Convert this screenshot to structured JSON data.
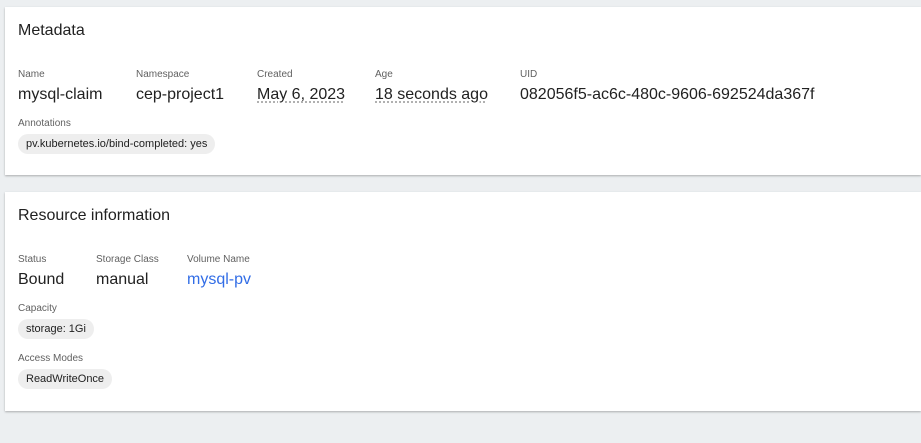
{
  "metadata": {
    "title": "Metadata",
    "name": {
      "label": "Name",
      "value": "mysql-claim"
    },
    "namespace": {
      "label": "Namespace",
      "value": "cep-project1"
    },
    "created": {
      "label": "Created",
      "value": "May 6, 2023"
    },
    "age": {
      "label": "Age",
      "value": "18 seconds ago"
    },
    "uid": {
      "label": "UID",
      "value": "082056f5-ac6c-480c-9606-692524da367f"
    },
    "annotations": {
      "label": "Annotations",
      "chips": [
        "pv.kubernetes.io/bind-completed: yes"
      ]
    }
  },
  "resource": {
    "title": "Resource information",
    "status": {
      "label": "Status",
      "value": "Bound"
    },
    "storage_class": {
      "label": "Storage Class",
      "value": "manual"
    },
    "volume_name": {
      "label": "Volume Name",
      "value": "mysql-pv"
    },
    "capacity": {
      "label": "Capacity",
      "chips": [
        "storage: 1Gi"
      ]
    },
    "access_modes": {
      "label": "Access Modes",
      "chips": [
        "ReadWriteOnce"
      ]
    }
  },
  "colors": {
    "link": "#326de6",
    "background": "#eceff1",
    "chip": "#eeeeee"
  }
}
